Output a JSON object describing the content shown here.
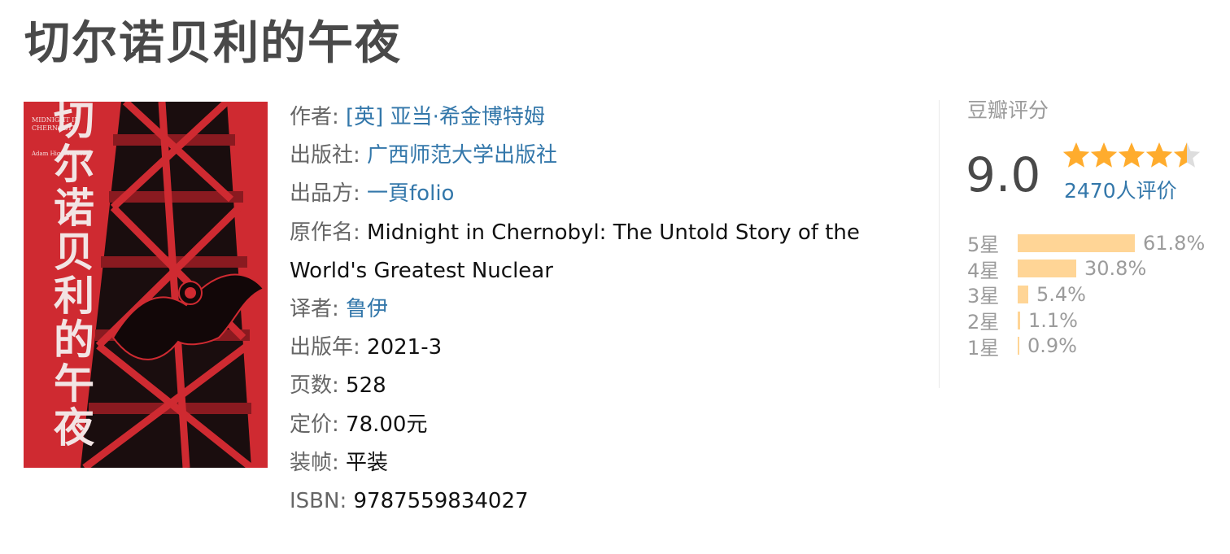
{
  "book": {
    "title": "切尔诺贝利的午夜"
  },
  "cover": {
    "title": "切尔诺贝利的午夜",
    "en_title": "MIDNIGHT IN CHERNOBYL",
    "author_small": "Adam Higginbotham"
  },
  "info": {
    "author": {
      "label": "作者:",
      "value": "[英] 亚当·希金博特姆"
    },
    "publisher": {
      "label": "出版社:",
      "value": "广西师范大学出版社"
    },
    "producer": {
      "label": "出品方:",
      "value": "一頁folio"
    },
    "original_title": {
      "label": "原作名:",
      "value": "Midnight in Chernobyl: The Untold Story of the World's Greatest Nuclear"
    },
    "translator": {
      "label": "译者:",
      "value": "鲁伊"
    },
    "pub_year": {
      "label": "出版年:",
      "value": "2021-3"
    },
    "pages": {
      "label": "页数:",
      "value": "528"
    },
    "price": {
      "label": "定价:",
      "value": "78.00元"
    },
    "binding": {
      "label": "装帧:",
      "value": "平装"
    },
    "isbn": {
      "label": "ISBN:",
      "value": "9787559834027"
    }
  },
  "rating": {
    "title": "豆瓣评分",
    "score": "9.0",
    "stars": 4.5,
    "count_text": "2470人评价",
    "bar_color": "#ffd596",
    "star_color": "#ffac2d",
    "distribution": [
      {
        "label": "5星",
        "percent": "61.8%",
        "value": 61.8
      },
      {
        "label": "4星",
        "percent": "30.8%",
        "value": 30.8
      },
      {
        "label": "3星",
        "percent": "5.4%",
        "value": 5.4
      },
      {
        "label": "2星",
        "percent": "1.1%",
        "value": 1.1
      },
      {
        "label": "1星",
        "percent": "0.9%",
        "value": 0.9
      }
    ]
  }
}
